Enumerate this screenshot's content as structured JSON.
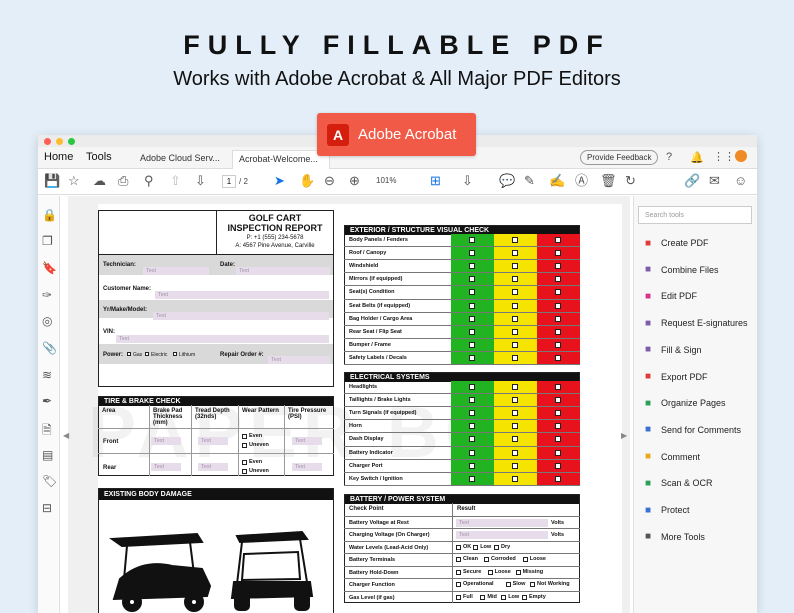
{
  "hero": {
    "title": "FULLY FILLABLE PDF",
    "subtitle": "Works with Adobe Acrobat & All Major PDF Editors",
    "badge": "Adobe Acrobat"
  },
  "app": {
    "nav_home": "Home",
    "nav_tools": "Tools",
    "tabs": [
      "Adobe Cloud Serv...",
      "Acrobat-Welcome..."
    ],
    "tab_close": "×",
    "feedback": "Provide Feedback",
    "page_current": "1",
    "page_total": "/ 2",
    "zoom": "101%",
    "search_placeholder": "Search tools",
    "tools": [
      {
        "label": "Create PDF",
        "icon": "create-pdf-icon",
        "color": "#e03a3a"
      },
      {
        "label": "Combine Files",
        "icon": "combine-files-icon",
        "color": "#7b5ea7"
      },
      {
        "label": "Edit PDF",
        "icon": "edit-pdf-icon",
        "color": "#d6338b"
      },
      {
        "label": "Request E-signatures",
        "icon": "request-esign-icon",
        "color": "#7b5ea7"
      },
      {
        "label": "Fill & Sign",
        "icon": "fill-sign-icon",
        "color": "#7b5ea7"
      },
      {
        "label": "Export PDF",
        "icon": "export-pdf-icon",
        "color": "#e03a3a"
      },
      {
        "label": "Organize Pages",
        "icon": "organize-pages-icon",
        "color": "#2e9e5b"
      },
      {
        "label": "Send for Comments",
        "icon": "send-comments-icon",
        "color": "#3b6fd1"
      },
      {
        "label": "Comment",
        "icon": "comment-icon",
        "color": "#e9a91b"
      },
      {
        "label": "Scan & OCR",
        "icon": "scan-ocr-icon",
        "color": "#2e9e5b"
      },
      {
        "label": "Protect",
        "icon": "protect-icon",
        "color": "#3b6fd1"
      },
      {
        "label": "More Tools",
        "icon": "more-tools-icon",
        "color": "#555555"
      }
    ]
  },
  "form": {
    "title_line1": "GOLF CART",
    "title_line2": "INSPECTION REPORT",
    "phone": "P: +1 (555) 234-5678",
    "address": "A: 4567 Pine Avenue, Carville",
    "field_placeholder": "Text",
    "technician": "Technician:",
    "date": "Date:",
    "customer_name": "Customer Name:",
    "yr_make_model": "Yr/Make/Model:",
    "vin": "VIN:",
    "power": "Power:",
    "power_options": [
      "Gas",
      "Electric",
      "Lithium"
    ],
    "repair_order": "Repair Order #:",
    "tire": {
      "title": "TIRE & BRAKE CHECK",
      "headers": [
        "Area",
        "Brake Pad Thickness (mm)",
        "Tread Depth (32nds)",
        "Wear Pattern",
        "Tire Pressure (PSI)"
      ],
      "rows": [
        "Front",
        "Rear"
      ],
      "wear_options": [
        "Even",
        "Uneven"
      ]
    },
    "damage_title": "EXISTING BODY DAMAGE",
    "exterior": {
      "title": "EXTERIOR / STRUCTURE VISUAL CHECK",
      "items": [
        "Body Panels / Fenders",
        "Roof / Canopy",
        "Windshield",
        "Mirrors (if equipped)",
        "Seat(s) Condition",
        "Seat Belts (if equipped)",
        "Bag Holder / Cargo Area",
        "Rear Seat / Flip Seat",
        "Bumper / Frame",
        "Safety Labels / Decals"
      ]
    },
    "electrical": {
      "title": "ELECTRICAL SYSTEMS",
      "items": [
        "Headlights",
        "Taillights / Brake Lights",
        "Turn Signals (if equipped)",
        "Horn",
        "Dash Display",
        "Battery Indicator",
        "Charger Port",
        "Key Switch / Ignition"
      ]
    },
    "battery": {
      "title": "BATTERY / POWER SYSTEM",
      "col_check": "Check Point",
      "col_result": "Result",
      "rows": [
        {
          "label": "Battery Voltage at Rest",
          "kind": "volts"
        },
        {
          "label": "Charging Voltage (On Charger)",
          "kind": "volts"
        },
        {
          "label": "Water Levels (Lead-Acid Only)",
          "kind": "opts",
          "opts": [
            "OK",
            "Low",
            "Dry"
          ]
        },
        {
          "label": "Battery Terminals",
          "kind": "opts",
          "opts": [
            "Clean",
            "Corroded",
            "Loose"
          ]
        },
        {
          "label": "Battery Hold-Down",
          "kind": "opts",
          "opts": [
            "Secure",
            "Loose",
            "Missing"
          ]
        },
        {
          "label": "Charger Function",
          "kind": "opts",
          "opts": [
            "Operational",
            "Slow",
            "Not Working"
          ]
        },
        {
          "label": "Gas Level (if gas)",
          "kind": "opts",
          "opts": [
            "Full",
            "Mid",
            "Low",
            "Empty"
          ]
        }
      ],
      "volts": "Volts"
    },
    "status_colors": [
      "#22b322",
      "#f5e400",
      "#e8121c"
    ]
  }
}
